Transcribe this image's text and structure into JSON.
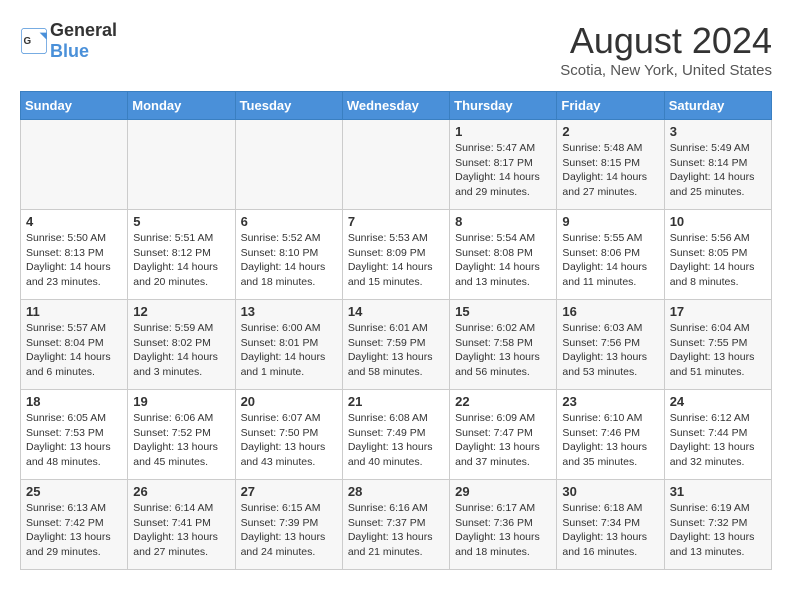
{
  "app": {
    "name_general": "General",
    "name_blue": "Blue"
  },
  "header": {
    "month": "August 2024",
    "location": "Scotia, New York, United States"
  },
  "weekdays": [
    "Sunday",
    "Monday",
    "Tuesday",
    "Wednesday",
    "Thursday",
    "Friday",
    "Saturday"
  ],
  "weeks": [
    [
      {
        "day": "",
        "info": ""
      },
      {
        "day": "",
        "info": ""
      },
      {
        "day": "",
        "info": ""
      },
      {
        "day": "",
        "info": ""
      },
      {
        "day": "1",
        "info": "Sunrise: 5:47 AM\nSunset: 8:17 PM\nDaylight: 14 hours\nand 29 minutes."
      },
      {
        "day": "2",
        "info": "Sunrise: 5:48 AM\nSunset: 8:15 PM\nDaylight: 14 hours\nand 27 minutes."
      },
      {
        "day": "3",
        "info": "Sunrise: 5:49 AM\nSunset: 8:14 PM\nDaylight: 14 hours\nand 25 minutes."
      }
    ],
    [
      {
        "day": "4",
        "info": "Sunrise: 5:50 AM\nSunset: 8:13 PM\nDaylight: 14 hours\nand 23 minutes."
      },
      {
        "day": "5",
        "info": "Sunrise: 5:51 AM\nSunset: 8:12 PM\nDaylight: 14 hours\nand 20 minutes."
      },
      {
        "day": "6",
        "info": "Sunrise: 5:52 AM\nSunset: 8:10 PM\nDaylight: 14 hours\nand 18 minutes."
      },
      {
        "day": "7",
        "info": "Sunrise: 5:53 AM\nSunset: 8:09 PM\nDaylight: 14 hours\nand 15 minutes."
      },
      {
        "day": "8",
        "info": "Sunrise: 5:54 AM\nSunset: 8:08 PM\nDaylight: 14 hours\nand 13 minutes."
      },
      {
        "day": "9",
        "info": "Sunrise: 5:55 AM\nSunset: 8:06 PM\nDaylight: 14 hours\nand 11 minutes."
      },
      {
        "day": "10",
        "info": "Sunrise: 5:56 AM\nSunset: 8:05 PM\nDaylight: 14 hours\nand 8 minutes."
      }
    ],
    [
      {
        "day": "11",
        "info": "Sunrise: 5:57 AM\nSunset: 8:04 PM\nDaylight: 14 hours\nand 6 minutes."
      },
      {
        "day": "12",
        "info": "Sunrise: 5:59 AM\nSunset: 8:02 PM\nDaylight: 14 hours\nand 3 minutes."
      },
      {
        "day": "13",
        "info": "Sunrise: 6:00 AM\nSunset: 8:01 PM\nDaylight: 14 hours\nand 1 minute."
      },
      {
        "day": "14",
        "info": "Sunrise: 6:01 AM\nSunset: 7:59 PM\nDaylight: 13 hours\nand 58 minutes."
      },
      {
        "day": "15",
        "info": "Sunrise: 6:02 AM\nSunset: 7:58 PM\nDaylight: 13 hours\nand 56 minutes."
      },
      {
        "day": "16",
        "info": "Sunrise: 6:03 AM\nSunset: 7:56 PM\nDaylight: 13 hours\nand 53 minutes."
      },
      {
        "day": "17",
        "info": "Sunrise: 6:04 AM\nSunset: 7:55 PM\nDaylight: 13 hours\nand 51 minutes."
      }
    ],
    [
      {
        "day": "18",
        "info": "Sunrise: 6:05 AM\nSunset: 7:53 PM\nDaylight: 13 hours\nand 48 minutes."
      },
      {
        "day": "19",
        "info": "Sunrise: 6:06 AM\nSunset: 7:52 PM\nDaylight: 13 hours\nand 45 minutes."
      },
      {
        "day": "20",
        "info": "Sunrise: 6:07 AM\nSunset: 7:50 PM\nDaylight: 13 hours\nand 43 minutes."
      },
      {
        "day": "21",
        "info": "Sunrise: 6:08 AM\nSunset: 7:49 PM\nDaylight: 13 hours\nand 40 minutes."
      },
      {
        "day": "22",
        "info": "Sunrise: 6:09 AM\nSunset: 7:47 PM\nDaylight: 13 hours\nand 37 minutes."
      },
      {
        "day": "23",
        "info": "Sunrise: 6:10 AM\nSunset: 7:46 PM\nDaylight: 13 hours\nand 35 minutes."
      },
      {
        "day": "24",
        "info": "Sunrise: 6:12 AM\nSunset: 7:44 PM\nDaylight: 13 hours\nand 32 minutes."
      }
    ],
    [
      {
        "day": "25",
        "info": "Sunrise: 6:13 AM\nSunset: 7:42 PM\nDaylight: 13 hours\nand 29 minutes."
      },
      {
        "day": "26",
        "info": "Sunrise: 6:14 AM\nSunset: 7:41 PM\nDaylight: 13 hours\nand 27 minutes."
      },
      {
        "day": "27",
        "info": "Sunrise: 6:15 AM\nSunset: 7:39 PM\nDaylight: 13 hours\nand 24 minutes."
      },
      {
        "day": "28",
        "info": "Sunrise: 6:16 AM\nSunset: 7:37 PM\nDaylight: 13 hours\nand 21 minutes."
      },
      {
        "day": "29",
        "info": "Sunrise: 6:17 AM\nSunset: 7:36 PM\nDaylight: 13 hours\nand 18 minutes."
      },
      {
        "day": "30",
        "info": "Sunrise: 6:18 AM\nSunset: 7:34 PM\nDaylight: 13 hours\nand 16 minutes."
      },
      {
        "day": "31",
        "info": "Sunrise: 6:19 AM\nSunset: 7:32 PM\nDaylight: 13 hours\nand 13 minutes."
      }
    ]
  ]
}
